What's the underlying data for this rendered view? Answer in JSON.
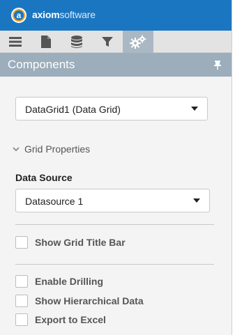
{
  "brand": {
    "logo_letter": "a",
    "name_bold": "axiom",
    "name_rest": "software"
  },
  "toolbar": {
    "tools": [
      {
        "icon": "menu-icon"
      },
      {
        "icon": "document-icon"
      },
      {
        "icon": "database-icon"
      },
      {
        "icon": "filter-icon"
      },
      {
        "icon": "gears-icon",
        "active": true
      }
    ]
  },
  "panel": {
    "title": "Components",
    "pin_icon": "pin-icon"
  },
  "component_select": {
    "value": "DataGrid1 (Data Grid)"
  },
  "grid_properties": {
    "label": "Grid Properties",
    "expanded": true
  },
  "data_source": {
    "label": "Data Source",
    "value": "Datasource 1"
  },
  "options": {
    "show_title_bar": {
      "label": "Show Grid Title Bar",
      "checked": false
    },
    "enable_drilling": {
      "label": "Enable Drilling",
      "checked": false
    },
    "show_hierarchical": {
      "label": "Show Hierarchical Data",
      "checked": false
    },
    "export_excel": {
      "label": "Export to Excel",
      "checked": false
    }
  },
  "colors": {
    "brand_blue": "#1b76c1",
    "logo_ring": "#f3a01f",
    "panel_header": "#9cadbb",
    "active_tab": "#aab8c4"
  }
}
